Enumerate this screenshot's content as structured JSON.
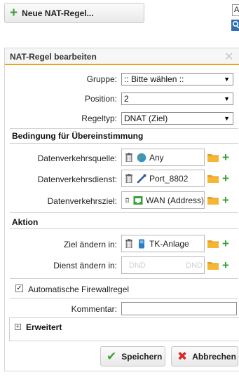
{
  "toolbar": {
    "new_rule_label": "Neue NAT-Regel..."
  },
  "corner": {
    "input_value": "A"
  },
  "dialog": {
    "title": "NAT-Regel bearbeiten",
    "group": {
      "label": "Gruppe:",
      "value": ":: Bitte wählen ::"
    },
    "position": {
      "label": "Position:",
      "value": "2"
    },
    "rule_type": {
      "label": "Regeltyp:",
      "value": "DNAT (Ziel)"
    },
    "match_section": {
      "title": "Bedingung für Übereinstimmung"
    },
    "traffic_source": {
      "label": "Datenverkehrsquelle:",
      "value": "Any",
      "icon": "globe-icon"
    },
    "traffic_service": {
      "label": "Datenverkehrsdienst:",
      "value": "Port_8802",
      "icon": "port-service-icon"
    },
    "traffic_destination": {
      "label": "Datenverkehrsziel:",
      "value": "WAN (Address)",
      "icon": "network-interface-icon"
    },
    "action_section": {
      "title": "Aktion"
    },
    "change_destination": {
      "label": "Ziel ändern in:",
      "value": "TK-Anlage",
      "icon": "host-icon"
    },
    "change_service": {
      "label": "Dienst ändern in:",
      "placeholder_left": "DND",
      "placeholder_right": "DND"
    },
    "auto_firewall": {
      "label": "Automatische Firewallregel",
      "checked": true
    },
    "comment": {
      "label": "Kommentar:",
      "value": ""
    },
    "advanced": {
      "label": "Erweitert"
    },
    "save_label": "Speichern",
    "cancel_label": "Abbrechen"
  },
  "colors": {
    "accent": "#f0a020",
    "add_green": "#3aa03a",
    "cancel_red": "#d62b2b"
  }
}
